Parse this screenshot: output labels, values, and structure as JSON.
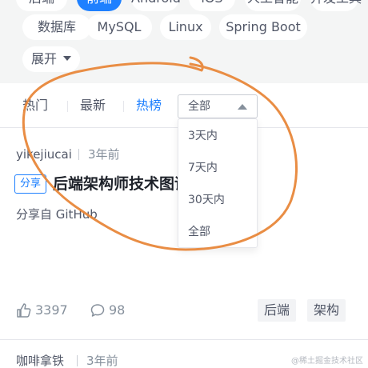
{
  "tags": {
    "row1": [
      "后端",
      "前端",
      "Android",
      "iOS",
      "人工智能",
      "开发工具"
    ],
    "row2": [
      "数据库",
      "MySQL",
      "Linux",
      "Spring Boot"
    ],
    "expand": "展开"
  },
  "sort": {
    "tabs": [
      "热门",
      "最新",
      "热榜"
    ],
    "active": "热榜",
    "range_selected": "全部",
    "range_options": [
      "3天内",
      "7天内",
      "30天内",
      "全部"
    ]
  },
  "article": {
    "author": "yikejiucai",
    "time": "3年前",
    "badge": "分享",
    "title": "后端架构师技术图谱",
    "desc": "分享自 GitHub",
    "likes": "3397",
    "comments": "98",
    "tags": [
      "后端",
      "架构"
    ]
  },
  "next_article": {
    "author": "咖啡拿铁",
    "time": "3年前"
  },
  "watermark": "@稀土掘金技术社区",
  "colors": {
    "accent": "#1e80ff",
    "annotation": "#e8873a"
  }
}
